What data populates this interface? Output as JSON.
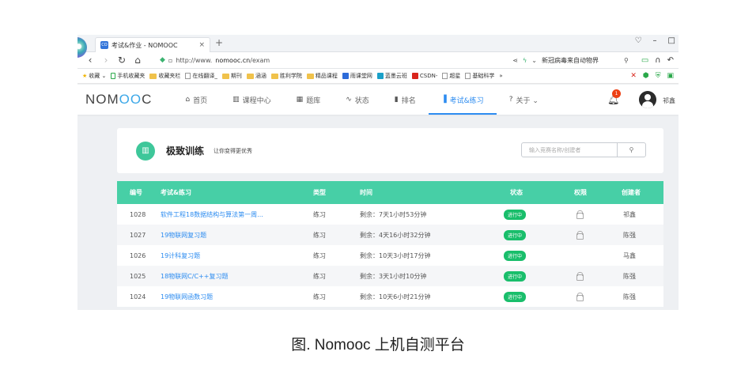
{
  "browser": {
    "tab_icon": "CO",
    "tab_title": "考试&作业 - NOMOOC",
    "tab_close": "×",
    "new_tab": "+",
    "url_prefix": "http://www.",
    "url_domain": "nomooc.cn",
    "url_path": "/exam",
    "search_text": "新冠病毒来自动物界",
    "window_controls": [
      "♡",
      "–",
      "□"
    ]
  },
  "bookmarks": [
    {
      "label": "收藏 ⌄",
      "icon": "star-icon"
    },
    {
      "label": "手机收藏夹",
      "icon": "phone-icon"
    },
    {
      "label": "收藏夹栏",
      "icon": "folder-icon"
    },
    {
      "label": "在线翻译_",
      "icon": "page-icon"
    },
    {
      "label": "期刊",
      "icon": "folder-icon"
    },
    {
      "label": "涵涵",
      "icon": "folder-icon"
    },
    {
      "label": "胜利学院",
      "icon": "folder-icon"
    },
    {
      "label": "精品课程",
      "icon": "folder-icon"
    },
    {
      "label": "雨课堂网",
      "icon": "square-blue-icon"
    },
    {
      "label": "蓝墨云班",
      "icon": "square-teal-icon"
    },
    {
      "label": "CSDN-",
      "icon": "csdn-icon"
    },
    {
      "label": "超星",
      "icon": "page-icon"
    },
    {
      "label": "基础科学",
      "icon": "page-icon"
    },
    {
      "label": "»",
      "icon": ""
    }
  ],
  "site": {
    "logo_a": "NOM",
    "logo_b": "OO",
    "logo_c": "C",
    "nav": [
      {
        "label": "首页",
        "icon": "⌂",
        "active": false
      },
      {
        "label": "课程中心",
        "icon": "▥",
        "active": false
      },
      {
        "label": "题库",
        "icon": "▦",
        "active": false
      },
      {
        "label": "状态",
        "icon": "∿",
        "active": false
      },
      {
        "label": "排名",
        "icon": "▮",
        "active": false
      },
      {
        "label": "考试&练习",
        "icon": "▐",
        "active": true
      },
      {
        "label": "关于 ⌄",
        "icon": "?",
        "active": false
      }
    ],
    "notification_count": "1",
    "username": "祁鑫"
  },
  "card": {
    "title": "极致训练",
    "subtitle": "让你变得更优秀",
    "search_placeholder": "输入竞赛名称/创建者"
  },
  "table": {
    "headers": [
      "编号",
      "考试&练习",
      "类型",
      "时间",
      "状态",
      "权限",
      "创建者"
    ],
    "rows": [
      {
        "id": "1028",
        "title": "软件工程18数据结构与算法第一周...",
        "type": "练习",
        "time": "剩余：7天1小时53分钟",
        "status": "进行中",
        "locked": true,
        "creator": "祁鑫"
      },
      {
        "id": "1027",
        "title": "19物联网复习题",
        "type": "练习",
        "time": "剩余：4天16小时32分钟",
        "status": "进行中",
        "locked": true,
        "creator": "陈强"
      },
      {
        "id": "1026",
        "title": "19计科复习题",
        "type": "练习",
        "time": "剩余：10天3小时17分钟",
        "status": "进行中",
        "locked": false,
        "creator": "马鑫"
      },
      {
        "id": "1025",
        "title": "18物联网C/C++复习题",
        "type": "练习",
        "time": "剩余：3天1小时10分钟",
        "status": "进行中",
        "locked": true,
        "creator": "陈强"
      },
      {
        "id": "1024",
        "title": "19物联网函数习题",
        "type": "练习",
        "time": "剩余：10天6小时21分钟",
        "status": "进行中",
        "locked": true,
        "creator": "陈强"
      }
    ]
  },
  "caption": "图. Nomooc 上机自测平台",
  "colors": {
    "accent": "#2d8cf0",
    "table_header": "#47cfa6",
    "status_green": "#19be6b"
  }
}
